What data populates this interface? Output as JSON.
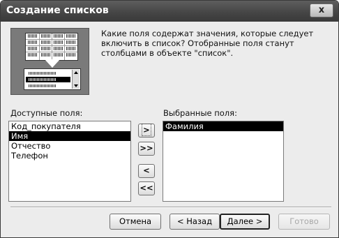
{
  "window": {
    "title": "Создание списков",
    "close_glyph": "x"
  },
  "description": "Какие поля содержат значения, которые следует включить в список? Отобранные поля станут столбцами в объекте \"список\".",
  "available": {
    "label": "Доступные поля:",
    "items": [
      "Код_покупателя",
      "Имя",
      "Отчество",
      "Телефон"
    ],
    "selected_index": 1
  },
  "selected": {
    "label": "Выбранные поля:",
    "items": [
      "Фамилия"
    ],
    "selected_index": 0
  },
  "move_buttons": {
    "add_one": ">",
    "add_all": ">>",
    "remove_one": "<",
    "remove_all": "<<"
  },
  "footer": {
    "cancel": "Отмена",
    "back": "< Назад",
    "next": "Далее >",
    "finish": "Готово"
  }
}
